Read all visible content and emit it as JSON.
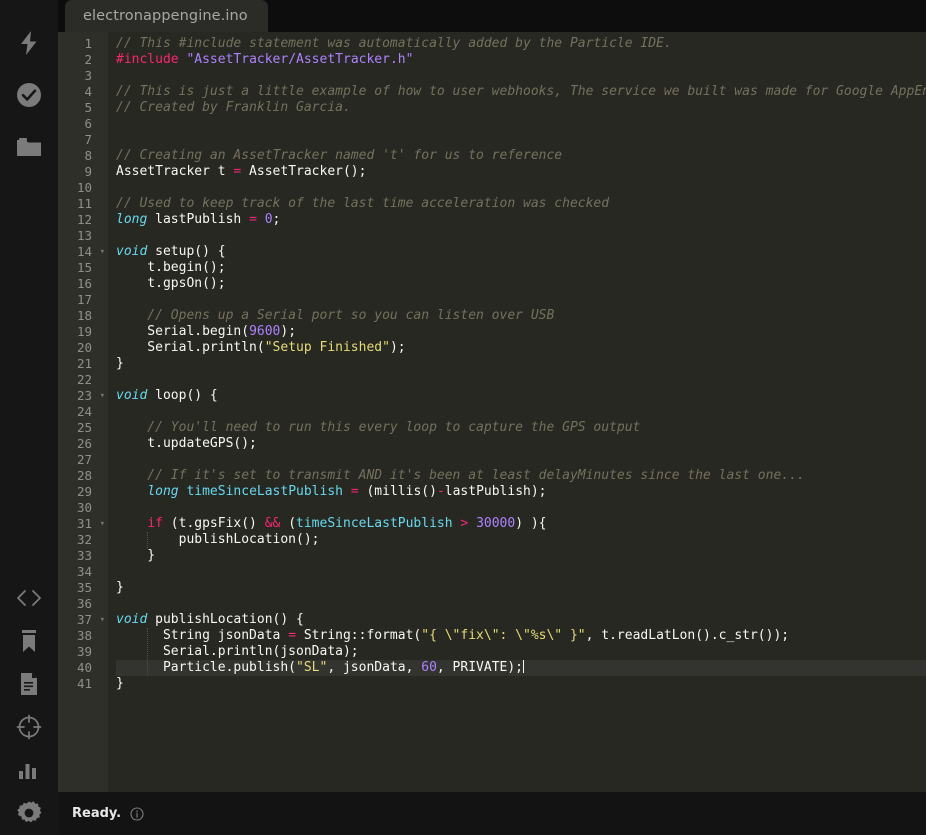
{
  "window": {
    "background": "#0d0d0d",
    "editor_background": "#272822",
    "gutter_background": "#2e2f28"
  },
  "tab": {
    "filename": "electronappengine.ino"
  },
  "rail": {
    "top_items": [
      {
        "name": "flash-icon",
        "label": "Flash"
      },
      {
        "name": "verify-icon",
        "label": "Verify"
      },
      {
        "name": "folder-icon",
        "label": "Open"
      }
    ],
    "bottom_items": [
      {
        "name": "code-icon",
        "label": "Code"
      },
      {
        "name": "bookmark-icon",
        "label": "Libraries"
      },
      {
        "name": "document-icon",
        "label": "Docs"
      },
      {
        "name": "target-icon",
        "label": "Devices"
      },
      {
        "name": "chart-icon",
        "label": "Console"
      },
      {
        "name": "gear-icon",
        "label": "Settings"
      }
    ]
  },
  "status": {
    "message": "Ready.",
    "info_icon": "info-circle-icon"
  },
  "editor": {
    "active_line": 40,
    "cursor_line": 40,
    "total_lines": 41,
    "fold_lines": [
      14,
      23,
      31,
      37
    ],
    "colors": {
      "comment": "#75715e",
      "keyword": "#f92672",
      "type": "#66d9ef",
      "string": "#e6db74",
      "number": "#ae81ff",
      "plain": "#f8f8f2",
      "line_number": "#8f908a",
      "active_line_bg": "#333430"
    },
    "lines": [
      {
        "n": 1,
        "tokens": [
          {
            "t": "// This #include statement was automatically added by the Particle IDE.",
            "k": "c"
          }
        ]
      },
      {
        "n": 2,
        "tokens": [
          {
            "t": "#include ",
            "k": "kw"
          },
          {
            "t": "\"AssetTracker/AssetTracker.h\"",
            "k": "sp"
          }
        ]
      },
      {
        "n": 3,
        "tokens": []
      },
      {
        "n": 4,
        "tokens": [
          {
            "t": "// This is just a little example of how to user webhooks, The service we built was made for Google AppEngine",
            "k": "c"
          }
        ]
      },
      {
        "n": 5,
        "tokens": [
          {
            "t": "// Created by Franklin Garcia.",
            "k": "c"
          }
        ]
      },
      {
        "n": 6,
        "tokens": []
      },
      {
        "n": 7,
        "tokens": []
      },
      {
        "n": 8,
        "tokens": [
          {
            "t": "// Creating an AssetTracker named 't' for us to reference",
            "k": "c"
          }
        ]
      },
      {
        "n": 9,
        "tokens": [
          {
            "t": "AssetTracker t ",
            "k": "pl"
          },
          {
            "t": "=",
            "k": "kw"
          },
          {
            "t": " AssetTracker();",
            "k": "pl"
          }
        ]
      },
      {
        "n": 10,
        "tokens": []
      },
      {
        "n": 11,
        "tokens": [
          {
            "t": "// Used to keep track of the last time acceleration was checked",
            "k": "c"
          }
        ]
      },
      {
        "n": 12,
        "tokens": [
          {
            "t": "long",
            "k": "ty"
          },
          {
            "t": " lastPublish ",
            "k": "pl"
          },
          {
            "t": "=",
            "k": "kw"
          },
          {
            "t": " ",
            "k": "pl"
          },
          {
            "t": "0",
            "k": "nu"
          },
          {
            "t": ";",
            "k": "pl"
          }
        ]
      },
      {
        "n": 13,
        "tokens": []
      },
      {
        "n": 14,
        "tokens": [
          {
            "t": "void",
            "k": "ty"
          },
          {
            "t": " setup() {",
            "k": "pl"
          }
        ]
      },
      {
        "n": 15,
        "tokens": [
          {
            "t": "    t.begin();",
            "k": "pl"
          }
        ]
      },
      {
        "n": 16,
        "tokens": [
          {
            "t": "    t.gpsOn();",
            "k": "pl"
          }
        ]
      },
      {
        "n": 17,
        "tokens": []
      },
      {
        "n": 18,
        "tokens": [
          {
            "t": "    // Opens up a Serial port so you can listen over USB",
            "k": "c"
          }
        ]
      },
      {
        "n": 19,
        "tokens": [
          {
            "t": "    Serial.begin(",
            "k": "pl"
          },
          {
            "t": "9600",
            "k": "nu"
          },
          {
            "t": ");",
            "k": "pl"
          }
        ]
      },
      {
        "n": 20,
        "tokens": [
          {
            "t": "    Serial.println(",
            "k": "pl"
          },
          {
            "t": "\"Setup Finished\"",
            "k": "st"
          },
          {
            "t": ");",
            "k": "pl"
          }
        ]
      },
      {
        "n": 21,
        "tokens": [
          {
            "t": "}",
            "k": "pl"
          }
        ]
      },
      {
        "n": 22,
        "tokens": []
      },
      {
        "n": 23,
        "tokens": [
          {
            "t": "void",
            "k": "ty"
          },
          {
            "t": " loop() {",
            "k": "pl"
          }
        ]
      },
      {
        "n": 24,
        "tokens": []
      },
      {
        "n": 25,
        "tokens": [
          {
            "t": "    // You'll need to run this every loop to capture the GPS output",
            "k": "c"
          }
        ]
      },
      {
        "n": 26,
        "tokens": [
          {
            "t": "    t.updateGPS();",
            "k": "pl"
          }
        ]
      },
      {
        "n": 27,
        "tokens": []
      },
      {
        "n": 28,
        "tokens": [
          {
            "t": "    // If it's set to transmit AND it's been at least delayMinutes since the last one...",
            "k": "c"
          }
        ]
      },
      {
        "n": 29,
        "tokens": [
          {
            "t": "    ",
            "k": "pl"
          },
          {
            "t": "long",
            "k": "ty"
          },
          {
            "t": " ",
            "k": "pl"
          },
          {
            "t": "timeSinceLastPublish",
            "k": "id"
          },
          {
            "t": " ",
            "k": "pl"
          },
          {
            "t": "=",
            "k": "kw"
          },
          {
            "t": " (millis()",
            "k": "pl"
          },
          {
            "t": "-",
            "k": "kw"
          },
          {
            "t": "lastPublish);",
            "k": "pl"
          }
        ]
      },
      {
        "n": 30,
        "tokens": []
      },
      {
        "n": 31,
        "tokens": [
          {
            "t": "    ",
            "k": "pl"
          },
          {
            "t": "if",
            "k": "kw"
          },
          {
            "t": " (t.gpsFix() ",
            "k": "pl"
          },
          {
            "t": "&&",
            "k": "kw"
          },
          {
            "t": " (",
            "k": "pl"
          },
          {
            "t": "timeSinceLastPublish",
            "k": "id"
          },
          {
            "t": " ",
            "k": "pl"
          },
          {
            "t": ">",
            "k": "kw"
          },
          {
            "t": " ",
            "k": "pl"
          },
          {
            "t": "30000",
            "k": "nu"
          },
          {
            "t": ") ){",
            "k": "pl"
          }
        ]
      },
      {
        "n": 32,
        "tokens": [
          {
            "t": "        publishLocation();",
            "k": "pl"
          }
        ]
      },
      {
        "n": 33,
        "tokens": [
          {
            "t": "    }",
            "k": "pl"
          }
        ]
      },
      {
        "n": 34,
        "tokens": []
      },
      {
        "n": 35,
        "tokens": [
          {
            "t": "}",
            "k": "pl"
          }
        ]
      },
      {
        "n": 36,
        "tokens": []
      },
      {
        "n": 37,
        "tokens": [
          {
            "t": "void",
            "k": "ty"
          },
          {
            "t": " publishLocation() {",
            "k": "pl"
          }
        ]
      },
      {
        "n": 38,
        "tokens": [
          {
            "t": "      String jsonData ",
            "k": "pl"
          },
          {
            "t": "=",
            "k": "kw"
          },
          {
            "t": " String::format(",
            "k": "pl"
          },
          {
            "t": "\"{ \\\"fix\\\": \\\"%s\\\" }\"",
            "k": "st"
          },
          {
            "t": ", t.readLatLon().c_str());",
            "k": "pl"
          }
        ]
      },
      {
        "n": 39,
        "tokens": [
          {
            "t": "      Serial.println(jsonData);",
            "k": "pl"
          }
        ]
      },
      {
        "n": 40,
        "tokens": [
          {
            "t": "      Particle.publish(",
            "k": "pl"
          },
          {
            "t": "\"SL\"",
            "k": "st"
          },
          {
            "t": ", jsonData, ",
            "k": "pl"
          },
          {
            "t": "60",
            "k": "nu"
          },
          {
            "t": ", PRIVATE);",
            "k": "pl"
          }
        ]
      },
      {
        "n": 41,
        "tokens": [
          {
            "t": "}",
            "k": "pl"
          }
        ]
      }
    ]
  }
}
